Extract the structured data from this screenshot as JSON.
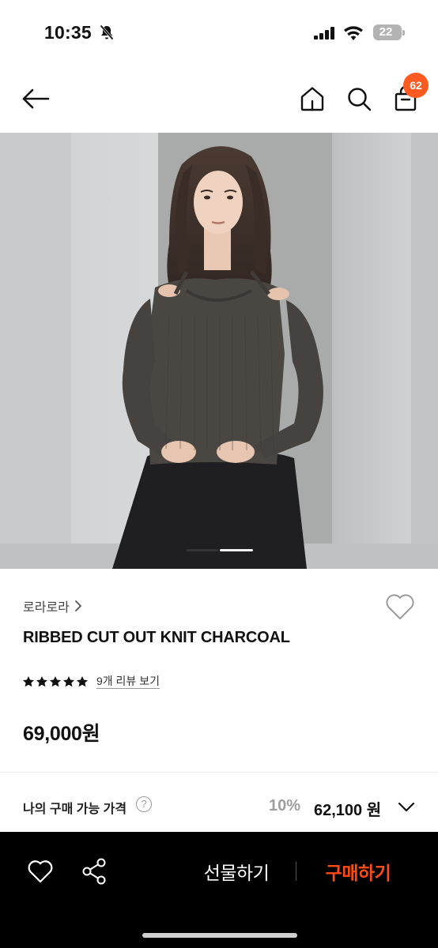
{
  "status_bar": {
    "time": "10:35",
    "battery": "22",
    "icons": [
      "bell-slash-icon",
      "cellular-signal-icon",
      "wifi-icon",
      "battery-icon"
    ]
  },
  "nav": {
    "icons": [
      "back-arrow-icon",
      "home-icon",
      "search-icon",
      "shopping-bag-icon"
    ],
    "cart_count": "62",
    "badge_color": "#ff5a1f"
  },
  "gallery": {
    "current_index": 1,
    "total_indicators": 2
  },
  "product": {
    "brand": "로라로라",
    "name": "RIBBED CUT OUT KNIT CHARCOAL",
    "rating_stars": 5,
    "review_link": "9개 리뷰 보기",
    "price": "69,000원"
  },
  "my_price": {
    "label": "나의 구매 가능 가격",
    "help_symbol": "?",
    "discount": "10%",
    "final_price": "62,100 원"
  },
  "action_bar": {
    "gift_label": "선물하기",
    "buy_label": "구매하기",
    "accent_color": "#ff4a17"
  }
}
